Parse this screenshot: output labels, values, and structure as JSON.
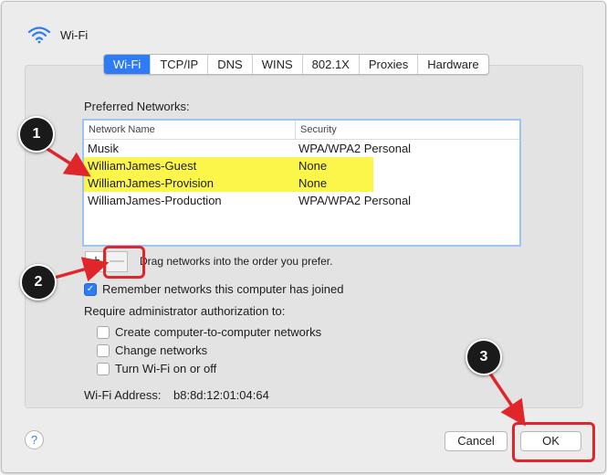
{
  "window": {
    "title": "Wi-Fi",
    "icon": "wifi-icon"
  },
  "tabs": [
    {
      "label": "Wi-Fi",
      "active": true
    },
    {
      "label": "TCP/IP",
      "active": false
    },
    {
      "label": "DNS",
      "active": false
    },
    {
      "label": "WINS",
      "active": false
    },
    {
      "label": "802.1X",
      "active": false
    },
    {
      "label": "Proxies",
      "active": false
    },
    {
      "label": "Hardware",
      "active": false
    }
  ],
  "preferred": {
    "label": "Preferred Networks:",
    "columns": [
      "Network Name",
      "Security"
    ],
    "rows": [
      {
        "name": "Musik",
        "security": "WPA/WPA2 Personal",
        "highlight": false
      },
      {
        "name": "WilliamJames-Guest",
        "security": "None",
        "highlight": true
      },
      {
        "name": "WilliamJames-Provision",
        "security": "None",
        "highlight": true
      },
      {
        "name": "WilliamJames-Production",
        "security": "WPA/WPA2 Personal",
        "highlight": false
      }
    ]
  },
  "controls": {
    "add": "+",
    "remove": "—",
    "drag_hint": "Drag networks into the order you prefer."
  },
  "remember": {
    "label": "Remember networks this computer has joined",
    "checked": true
  },
  "admin": {
    "label": "Require administrator authorization to:",
    "options": [
      {
        "label": "Create computer-to-computer networks",
        "checked": false
      },
      {
        "label": "Change networks",
        "checked": false
      },
      {
        "label": "Turn Wi-Fi on or off",
        "checked": false
      }
    ]
  },
  "address": {
    "label": "Wi-Fi Address:",
    "value": "b8:8d:12:01:04:64"
  },
  "buttons": {
    "help": "?",
    "cancel": "Cancel",
    "ok": "OK"
  },
  "annotations": {
    "one": "1",
    "two": "2",
    "three": "3",
    "color": "#e0262b"
  },
  "colors": {
    "accent": "#2f7bf5",
    "highlight": "#fcf64a"
  }
}
